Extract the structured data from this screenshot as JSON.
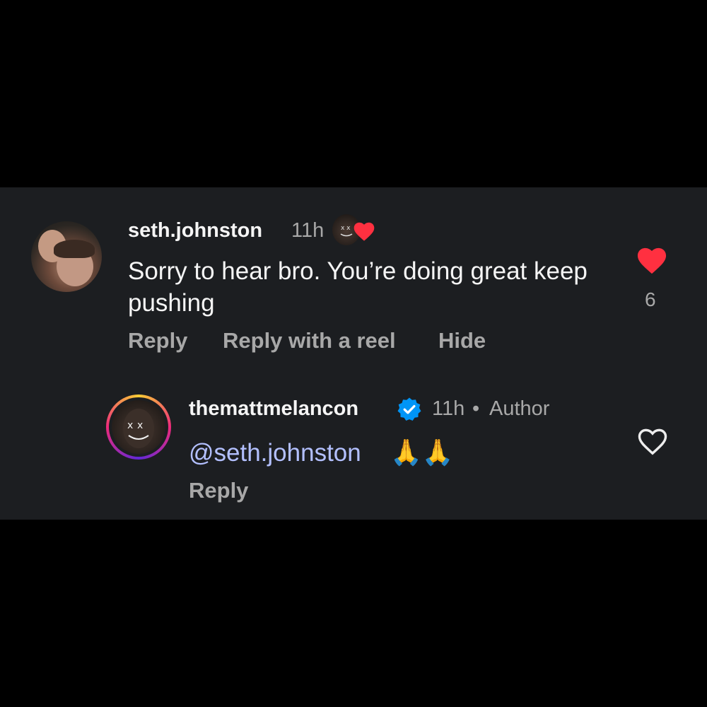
{
  "comment": {
    "username": "seth.johnston",
    "time": "11h",
    "text": "Sorry to hear bro. You’re doing great keep pushing",
    "like_count": "6",
    "actions": {
      "reply": "Reply",
      "reply_reel": "Reply with a reel",
      "hide": "Hide"
    },
    "liked": true
  },
  "reply": {
    "username": "themattmelancon",
    "verified": true,
    "time": "11h",
    "separator": "•",
    "role": "Author",
    "mention": "@seth.johnston",
    "emoji": "🙏🙏",
    "action_reply": "Reply",
    "liked": false
  },
  "colors": {
    "background": "#000000",
    "panel": "#1c1e21",
    "heart_red": "#ff3040",
    "verified_blue": "#0095f6",
    "mention": "#b3c0ff",
    "muted": "#a8a8a8"
  },
  "icons": {
    "liked_heart": "heart-filled-icon",
    "unliked_heart": "heart-outline-icon",
    "verified": "verified-badge-icon",
    "creator_heart": "creator-liked-heart-icon"
  }
}
